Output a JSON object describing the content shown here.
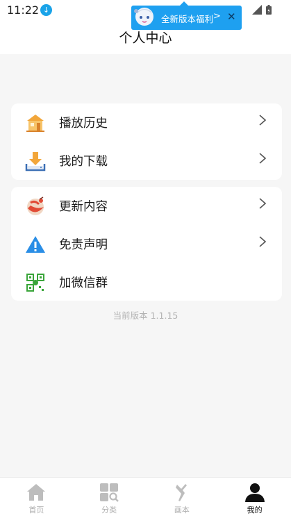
{
  "status_bar": {
    "time": "11:22"
  },
  "header": {
    "title": "个人中心"
  },
  "promo": {
    "text": "全新版本福利",
    "chevron": ">",
    "close": "✕"
  },
  "menu_group_1": [
    {
      "label": "播放历史",
      "icon": "house-icon"
    },
    {
      "label": "我的下载",
      "icon": "download-icon"
    }
  ],
  "menu_group_2": [
    {
      "label": "更新内容",
      "icon": "update-icon"
    },
    {
      "label": "免责声明",
      "icon": "warning-icon"
    },
    {
      "label": "加微信群",
      "icon": "qr-code-icon"
    }
  ],
  "version": "当前版本 1.1.15",
  "tabbar": [
    {
      "label": "首页",
      "icon": "home-icon",
      "active": false
    },
    {
      "label": "分类",
      "icon": "category-icon",
      "active": false
    },
    {
      "label": "画本",
      "icon": "brush-icon",
      "active": false
    },
    {
      "label": "我的",
      "icon": "profile-icon",
      "active": true
    }
  ],
  "colors": {
    "accent": "#1ea0f0",
    "background": "#f6f6f6",
    "card": "#ffffff",
    "warning": "#2a8ee6"
  }
}
